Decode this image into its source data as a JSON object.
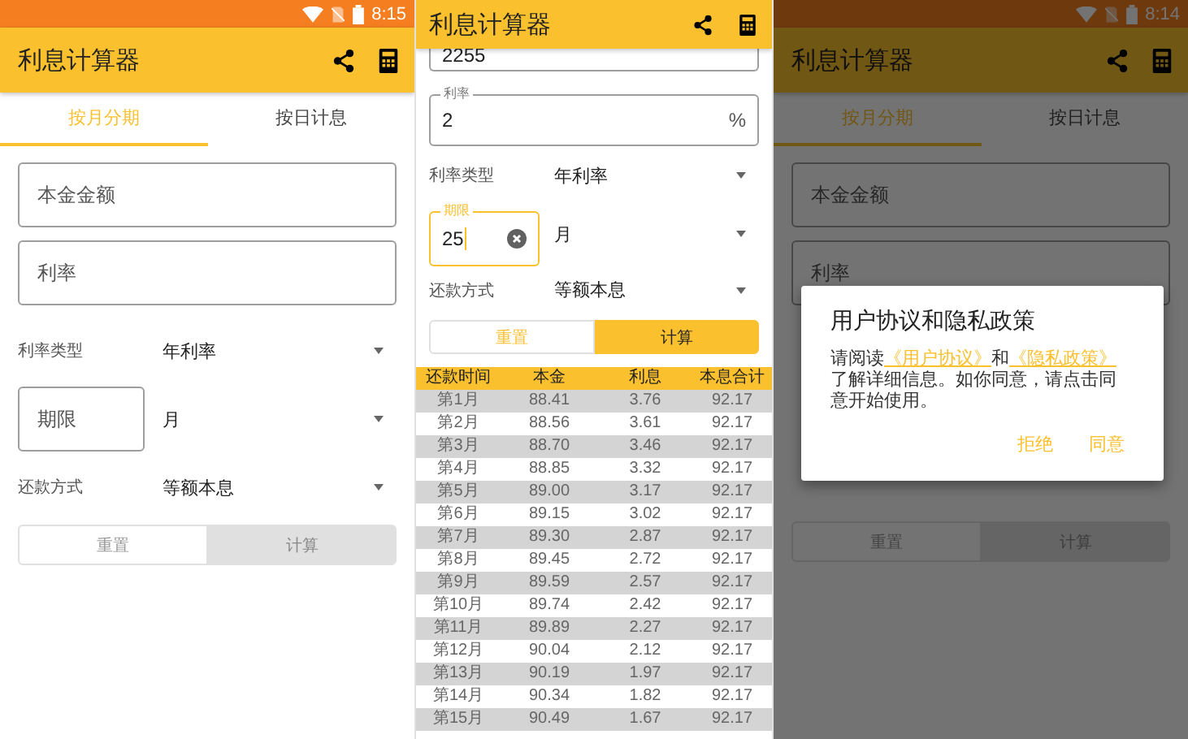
{
  "monthly_screen": {
    "status_bar": {
      "time": "8:15"
    },
    "title": "利息计算器",
    "tabs": [
      {
        "label": "按月分期",
        "selected": true
      },
      {
        "label": "按日计息",
        "selected": false
      }
    ],
    "fields": [
      {
        "placeholder": "本金金额"
      },
      {
        "placeholder": "利率"
      }
    ],
    "rate_type": {
      "label": "利率类型",
      "value": "年利率"
    },
    "term": {
      "placeholder": "期限",
      "unit": "月"
    },
    "method": {
      "label": "还款方式",
      "value": "等额本息"
    },
    "buttons": [
      {
        "label": "重置",
        "kind": "outline",
        "disabled": true
      },
      {
        "label": "计算",
        "kind": "filled",
        "disabled": true
      }
    ]
  },
  "result_screen": {
    "title": "利息计算器",
    "principal": {
      "value": "2255"
    },
    "rate": {
      "label": "利率",
      "value": "2",
      "suffix": "%"
    },
    "rate_type": {
      "label": "利率类型",
      "value": "年利率"
    },
    "term": {
      "label": "期限",
      "value": "25",
      "focused": true,
      "unit": "月"
    },
    "method": {
      "label": "还款方式",
      "value": "等额本息"
    },
    "buttons": [
      {
        "label": "重置",
        "kind": "outline",
        "disabled": false
      },
      {
        "label": "计算",
        "kind": "filled",
        "disabled": false
      }
    ],
    "table": {
      "columns": [
        "还款时间",
        "本金",
        "利息",
        "本息合计"
      ],
      "rows": [
        [
          "第1月",
          "88.41",
          "3.76",
          "92.17"
        ],
        [
          "第2月",
          "88.56",
          "3.61",
          "92.17"
        ],
        [
          "第3月",
          "88.70",
          "3.46",
          "92.17"
        ],
        [
          "第4月",
          "88.85",
          "3.32",
          "92.17"
        ],
        [
          "第5月",
          "89.00",
          "3.17",
          "92.17"
        ],
        [
          "第6月",
          "89.15",
          "3.02",
          "92.17"
        ],
        [
          "第7月",
          "89.30",
          "2.87",
          "92.17"
        ],
        [
          "第8月",
          "89.45",
          "2.72",
          "92.17"
        ],
        [
          "第9月",
          "89.59",
          "2.57",
          "92.17"
        ],
        [
          "第10月",
          "89.74",
          "2.42",
          "92.17"
        ],
        [
          "第11月",
          "89.89",
          "2.27",
          "92.17"
        ],
        [
          "第12月",
          "90.04",
          "2.12",
          "92.17"
        ],
        [
          "第13月",
          "90.19",
          "1.97",
          "92.17"
        ],
        [
          "第14月",
          "90.34",
          "1.82",
          "92.17"
        ],
        [
          "第15月",
          "90.49",
          "1.67",
          "92.17"
        ]
      ]
    }
  },
  "dialog_screen": {
    "status_bar": {
      "time": "8:14"
    },
    "title": "利息计算器",
    "tabs": [
      {
        "label": "按月分期",
        "selected": true
      },
      {
        "label": "按日计息",
        "selected": false
      }
    ],
    "fields": [
      {
        "placeholder": "本金金额"
      },
      {
        "placeholder": "利率"
      }
    ],
    "buttons": [
      {
        "label": "重置",
        "kind": "outline",
        "disabled": true
      },
      {
        "label": "计算",
        "kind": "filled",
        "disabled": true
      }
    ],
    "dialog": {
      "title": "用户协议和隐私政策",
      "message": [
        {
          "kind": "text",
          "text": "请阅读"
        },
        {
          "kind": "link",
          "text": "《用户协议》"
        },
        {
          "kind": "text",
          "text": "和"
        },
        {
          "kind": "link",
          "text": "《隐私政策》"
        },
        {
          "kind": "text",
          "text": "了解详细信息。如你同意，请点击同意开始使用。"
        }
      ],
      "actions": [
        "拒绝",
        "同意"
      ]
    }
  }
}
